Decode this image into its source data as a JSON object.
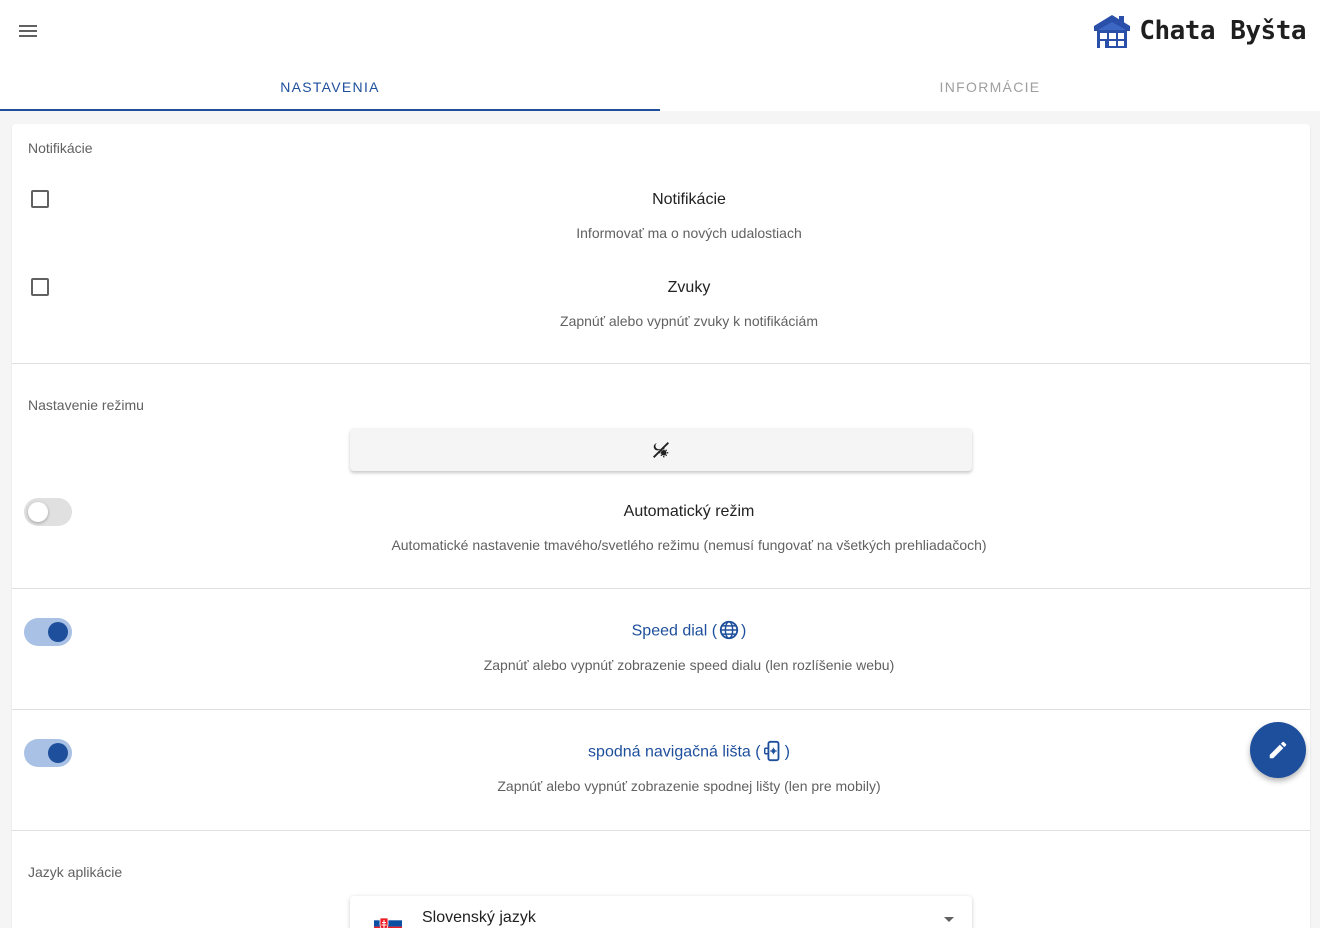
{
  "app": {
    "brand_name": "Chata Byšta",
    "logo_icon": "house-logo-icon",
    "menu_icon": "menu-icon"
  },
  "tabs": [
    {
      "label": "NASTAVENIA",
      "active": true
    },
    {
      "label": "INFORMÁCIE",
      "active": false
    }
  ],
  "notifications_section": {
    "header": "Notifikácie",
    "items": [
      {
        "title": "Notifikácie",
        "subtitle": "Informovať ma o nových udalostiach",
        "checked": false
      },
      {
        "title": "Zvuky",
        "subtitle": "Zapnúť alebo vypnúť zvuky k notifikáciám",
        "checked": false
      }
    ]
  },
  "mode_section": {
    "header": "Nastavenie režimu",
    "mode_button_icon": "theme-light-dark-icon",
    "auto_mode": {
      "title": "Automatický režim",
      "subtitle": "Automatické nastavenie tmavého/svetlého režimu (nemusí fungovať na všetkých prehliadačoch)",
      "enabled": false
    }
  },
  "speed_dial": {
    "title": "Speed dial",
    "paren_open": "(",
    "paren_close": ")",
    "icon": "globe-icon",
    "subtitle": "Zapnúť alebo vypnúť zobrazenie speed dialu (len rozlíšenie webu)",
    "enabled": true
  },
  "bottom_nav": {
    "title": "spodná navigačná lišta",
    "paren_open": "(",
    "paren_close": ")",
    "icon": "mobile-settings-icon",
    "subtitle": "Zapnúť alebo vypnúť zobrazenie spodnej lišty (len pre mobily)",
    "enabled": true
  },
  "language_section": {
    "header": "Jazyk aplikácie",
    "selected": "Slovenský jazyk",
    "flag_icon": "slovak-flag-icon"
  },
  "fab_icon": "pencil-icon",
  "colors": {
    "primary": "#1e4f9c",
    "switch_track_on": "#a9c1e4",
    "divider": "#e0e0e0",
    "background": "#f5f5f5"
  }
}
